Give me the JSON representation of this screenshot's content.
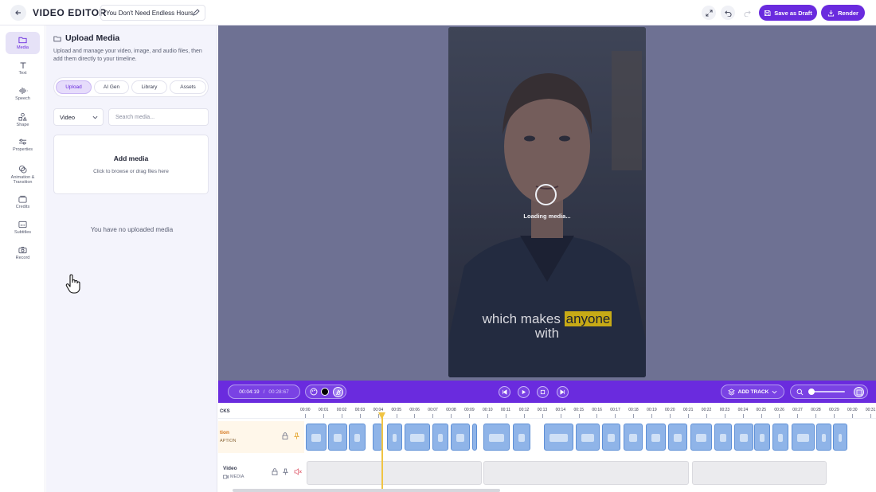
{
  "topbar": {
    "app_title": "VIDEO EDITOR",
    "project_name": "You Don't Need Endless Hours",
    "save_draft_label": "Save as Draft",
    "render_label": "Render"
  },
  "sidebar": {
    "items": [
      {
        "label": "Media",
        "icon": "folder-icon",
        "active": true
      },
      {
        "label": "Text",
        "icon": "text-icon"
      },
      {
        "label": "Speech",
        "icon": "waveform-icon"
      },
      {
        "label": "Shape",
        "icon": "shapes-icon"
      },
      {
        "label": "Properties",
        "icon": "sliders-icon"
      },
      {
        "label": "Animation & Transition",
        "icon": "animation-icon"
      },
      {
        "label": "Credits",
        "icon": "credits-icon"
      },
      {
        "label": "Subtitles",
        "icon": "subtitles-icon"
      },
      {
        "label": "Record",
        "icon": "camera-icon"
      }
    ]
  },
  "panel": {
    "title": "Upload Media",
    "description": "Upload and manage your video, image, and audio files, then add them directly to your timeline.",
    "tabs": [
      "Upload",
      "AI Gen",
      "Library",
      "Assets"
    ],
    "active_tab": "Upload",
    "media_type": "Video",
    "search_placeholder": "Search media...",
    "dropzone_title": "Add media",
    "dropzone_subtitle": "Click to browse or drag files here",
    "empty_message": "You have no uploaded media"
  },
  "preview": {
    "loading_text": "Loading media...",
    "caption_line1_before": "which makes",
    "caption_highlight": "anyone",
    "caption_line2": "with"
  },
  "transport": {
    "current_time": "00:04:19",
    "separator": "/",
    "duration": "00:28:67",
    "add_track_label": "ADD TRACK"
  },
  "timeline": {
    "tracks_label": "CKS",
    "ticks": [
      "00:00",
      "00:01",
      "00:02",
      "00:03",
      "00:04",
      "00:05",
      "00:06",
      "00:07",
      "00:08",
      "00:09",
      "00:10",
      "00:11",
      "00:12",
      "00:13",
      "00:14",
      "00:15",
      "00:16",
      "00:17",
      "00:18",
      "00:19",
      "00:20",
      "00:21",
      "00:22",
      "00:23",
      "00:24",
      "00:25",
      "00:26",
      "00:27",
      "00:28",
      "00:29",
      "00:30",
      "00:31"
    ],
    "caption_track_name": "tion",
    "caption_track_type": "APTION",
    "video_track_name": "Video",
    "video_track_type": "MEDIA"
  },
  "colors": {
    "accent": "#6a2bde",
    "preview_bg": "#6e7193",
    "caption_highlight": "#c7aa16",
    "playhead": "#f0c443"
  }
}
